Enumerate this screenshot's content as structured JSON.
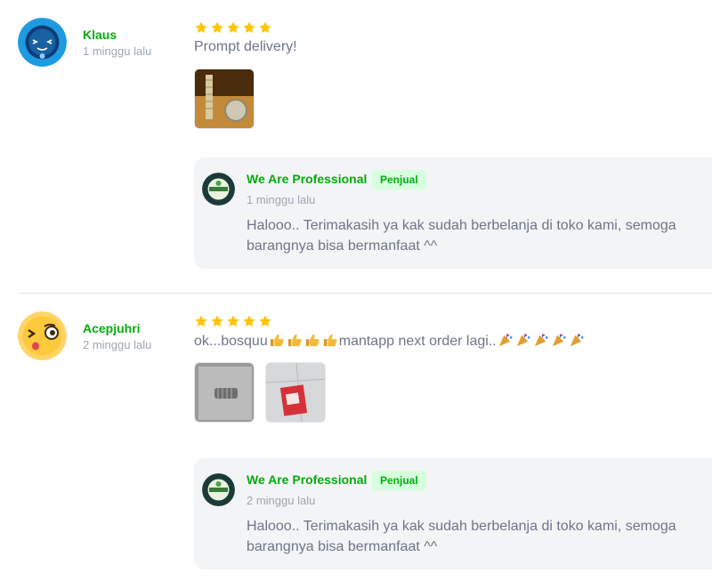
{
  "reviews": [
    {
      "username": "Klaus",
      "time": "1 minggu lalu",
      "rating": 5,
      "text": "Prompt delivery!",
      "reply": {
        "seller_name": "We Are Professional",
        "badge": "Penjual",
        "time": "1 minggu lalu",
        "text": "Halooo.. Terimakasih ya kak sudah berbelanja di toko kami, semoga barangnya bisa bermanfaat ^^"
      }
    },
    {
      "username": "Acepjuhri",
      "time": "2 minggu lalu",
      "rating": 5,
      "text_before_emoji": "ok...bosquu",
      "text_middle": "mantapp next order lagi..",
      "reply": {
        "seller_name": "We Are Professional",
        "badge": "Penjual",
        "time": "2 minggu lalu",
        "text": "Halooo.. Terimakasih ya kak sudah berbelanja di toko kami, semoga barangnya bisa bermanfaat ^^"
      }
    }
  ],
  "icons": {
    "star": "star-icon",
    "thumbs_up": "thumbs-up-emoji",
    "party_popper": "party-popper-emoji"
  },
  "colors": {
    "accent_green": "#03ac0e",
    "badge_bg": "#d6ffde",
    "star": "#ffc400",
    "muted_text": "#9fa6b0",
    "body_text": "#6d7588",
    "reply_bg": "#f3f4f5"
  }
}
